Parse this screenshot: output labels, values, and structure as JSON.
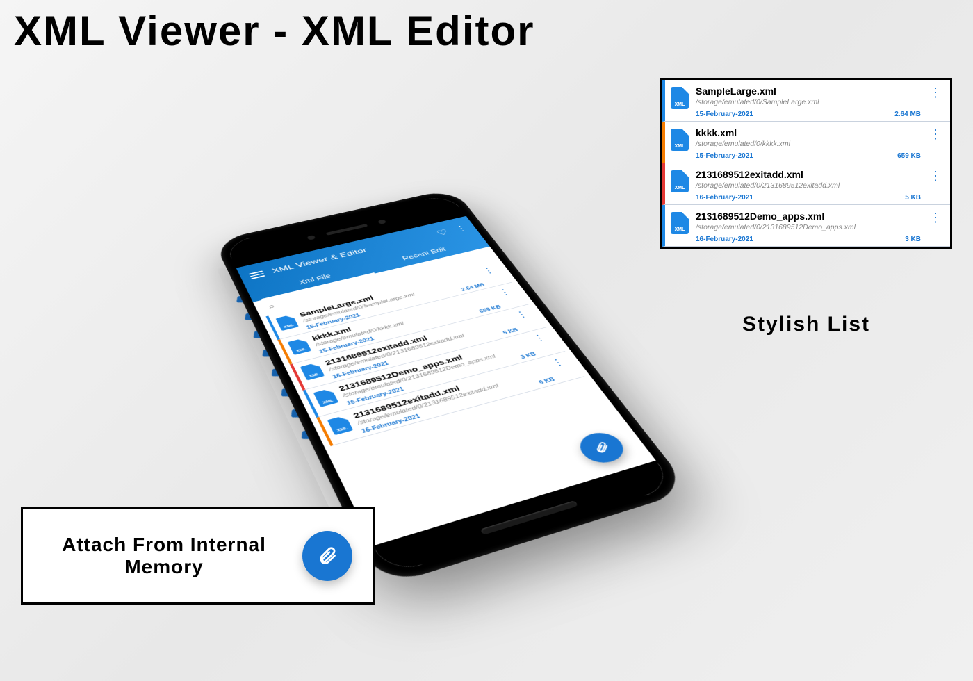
{
  "colors": {
    "accent": "#1976d2"
  },
  "title": "XML Viewer - XML Editor",
  "right_caption": "Stylish List",
  "attach_callout": "Attach From Internal Memory",
  "app": {
    "header_title": "XML Viewer & Editor",
    "tabs": {
      "xml_file": "Xml File",
      "recent_edit": "Recent Edit"
    }
  },
  "files": [
    {
      "name": "SampleLarge.xml",
      "path": "/storage/emulated/0/SampleLarge.xml",
      "date": "15-February-2021",
      "size": "2.64 MB",
      "stripe": "#1e88e5"
    },
    {
      "name": "kkkk.xml",
      "path": "/storage/emulated/0/kkkk.xml",
      "date": "15-February-2021",
      "size": "659 KB",
      "stripe": "#f57c00"
    },
    {
      "name": "2131689512exitadd.xml",
      "path": "/storage/emulated/0/2131689512exitadd.xml",
      "date": "16-February-2021",
      "size": "5 KB",
      "stripe": "#e53935"
    },
    {
      "name": "2131689512Demo_apps.xml",
      "path": "/storage/emulated/0/2131689512Demo_apps.xml",
      "date": "16-February-2021",
      "size": "3 KB",
      "stripe": "#1e88e5"
    },
    {
      "name": "2131689512exitadd.xml",
      "path": "/storage/emulated/0/2131689512exitadd.xml",
      "date": "16-February-2021",
      "size": "5 KB",
      "stripe": "#f57c00"
    }
  ],
  "panel_files": [
    {
      "name": "SampleLarge.xml",
      "path": "/storage/emulated/0/SampleLarge.xml",
      "date": "15-February-2021",
      "size": "2.64 MB",
      "stripe": "#1e88e5"
    },
    {
      "name": "kkkk.xml",
      "path": "/storage/emulated/0/kkkk.xml",
      "date": "15-February-2021",
      "size": "659 KB",
      "stripe": "#f57c00"
    },
    {
      "name": "2131689512exitadd.xml",
      "path": "/storage/emulated/0/2131689512exitadd.xml",
      "date": "16-February-2021",
      "size": "5 KB",
      "stripe": "#e53935"
    },
    {
      "name": "2131689512Demo_apps.xml",
      "path": "/storage/emulated/0/2131689512Demo_apps.xml",
      "date": "16-February-2021",
      "size": "3 KB",
      "stripe": "#1e88e5"
    }
  ]
}
